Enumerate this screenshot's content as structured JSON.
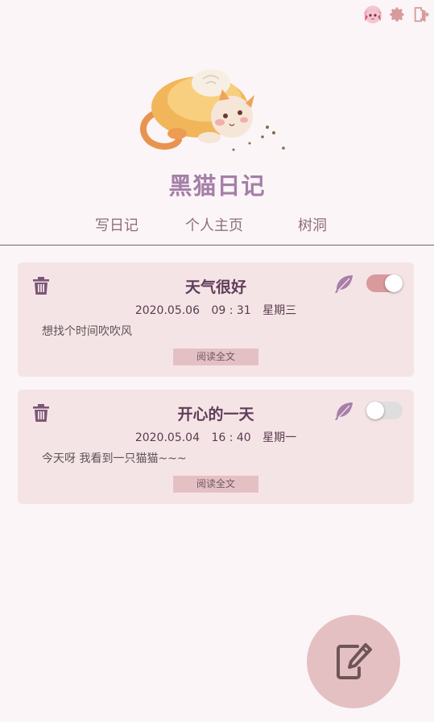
{
  "app": {
    "title": "黑猫日记"
  },
  "topbar": {
    "icons": [
      "avatar-icon",
      "gear-icon",
      "logout-icon"
    ]
  },
  "nav": {
    "tabs": [
      {
        "label": "写日记"
      },
      {
        "label": "个人主页"
      },
      {
        "label": "树洞"
      }
    ]
  },
  "entries": [
    {
      "title": "天气很好",
      "date": "2020.05.06",
      "time": "09 : 31",
      "weekday": "星期三",
      "excerpt": "想找个时间吹吹风",
      "read_label": "阅读全文",
      "public": true
    },
    {
      "title": "开心的一天",
      "date": "2020.05.04",
      "time": "16 : 40",
      "weekday": "星期一",
      "excerpt": "今天呀 我看到一只猫猫~~~",
      "read_label": "阅读全文",
      "public": false
    }
  ],
  "colors": {
    "accent": "#a47fa7",
    "card": "#f5e4e6",
    "toggle_on": "#d89a9d",
    "toggle_off": "#dedede",
    "fab": "#e4c0c3"
  }
}
